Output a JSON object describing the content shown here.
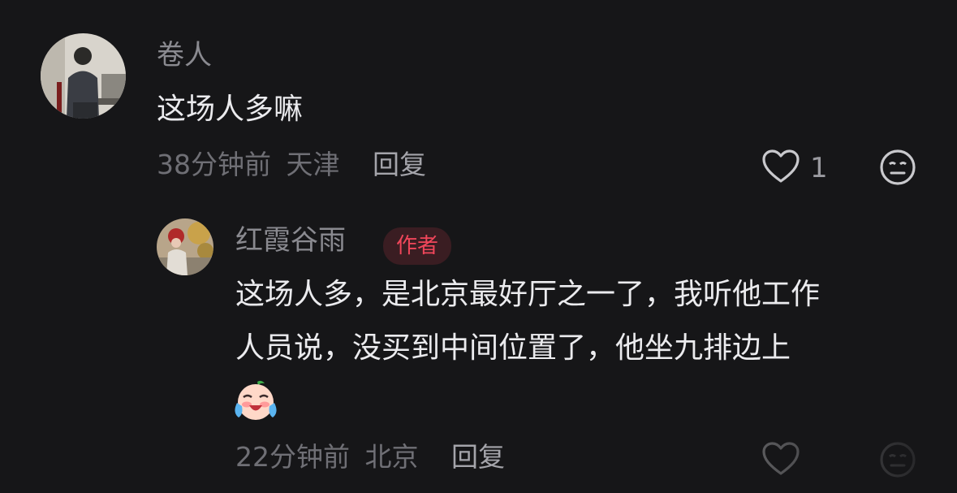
{
  "comments": [
    {
      "username": "卷人",
      "text": "这场人多嘛",
      "time": "38分钟前",
      "location": "天津",
      "reply_label": "回复",
      "likes": "1"
    },
    {
      "username": "红霞谷雨",
      "badge": "作者",
      "text_line1": "这场人多，是北京最好厅之一了，我听他工作",
      "text_line2": "人员说，没买到中间位置了，他坐九排边上",
      "time": "22分钟前",
      "location": "北京",
      "reply_label": "回复"
    }
  ],
  "icons": {
    "like": "heart-icon",
    "dislike": "meh-face-icon",
    "emoji": "crying-laughing-emoji"
  },
  "colors": {
    "background": "#161618",
    "badge_text": "#f0465a",
    "badge_bg": "#3a1d22"
  }
}
